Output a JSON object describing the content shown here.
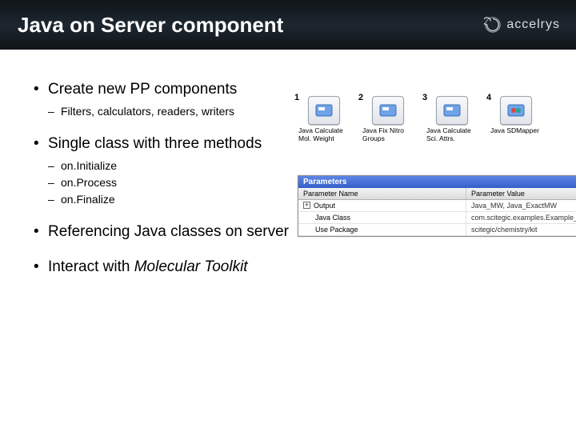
{
  "title": "Java on Server component",
  "brand": "accelrys",
  "bullets": [
    {
      "text": "Create new PP components",
      "sub": [
        "Filters, calculators, readers, writers"
      ]
    },
    {
      "text": "Single class with three methods",
      "sub": [
        "on.Initialize",
        "on.Process",
        "on.Finalize"
      ]
    },
    {
      "text": "Referencing Java classes on server",
      "sub": []
    },
    {
      "text_html": "Interact with <em class='word'>Molecular Toolkit</em>",
      "sub": []
    }
  ],
  "components": [
    {
      "index": "1",
      "label": "Java Calculate Mol. Weight"
    },
    {
      "index": "2",
      "label": "Java Fix Nitro Groups"
    },
    {
      "index": "3",
      "label": "Java Calculate Sci. Attrs."
    },
    {
      "index": "4",
      "label": "Java SDMapper"
    }
  ],
  "param_panel": {
    "title": "Parameters",
    "headers": {
      "name": "Parameter Name",
      "value": "Parameter Value"
    },
    "rows": [
      {
        "toggle": "+",
        "name": "Output",
        "value": "Java_MW, Java_ExactMW"
      },
      {
        "toggle": "",
        "name": "Java Class",
        "value": "com.scitegic.examples.Example_CalcMolweight"
      },
      {
        "toggle": "",
        "name": "Use Package",
        "value": "scitegic/chemistry/kit"
      }
    ]
  }
}
